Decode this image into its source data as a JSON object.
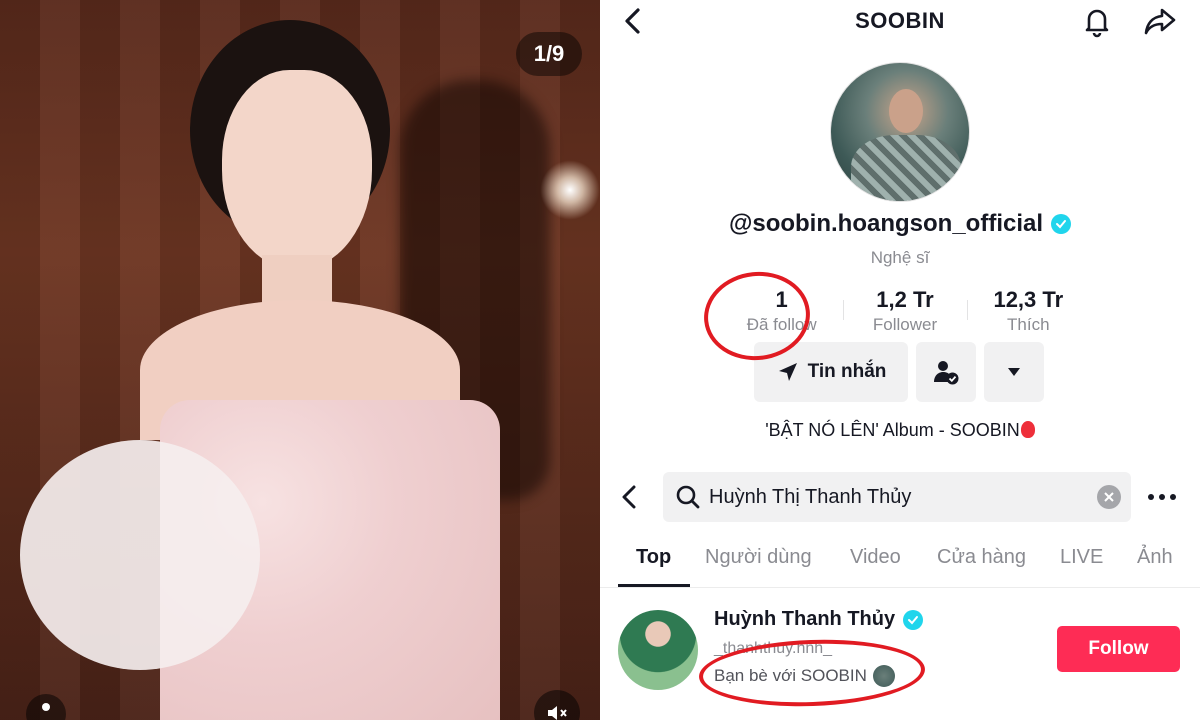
{
  "photo": {
    "counter": "1/9"
  },
  "profile": {
    "title": "SOOBIN",
    "handle": "@soobin.hoangson_official",
    "subtitle": "Nghệ sĩ",
    "stats": [
      {
        "value": "1",
        "label": "Đã follow"
      },
      {
        "value": "1,2 Tr",
        "label": "Follower"
      },
      {
        "value": "12,3 Tr",
        "label": "Thích"
      }
    ],
    "message_button": "Tin nhắn",
    "bio": "'BẬT NÓ LÊN' Album - SOOBIN"
  },
  "search": {
    "query": "Huỳnh Thị Thanh Thủy",
    "tabs": [
      "Top",
      "Người dùng",
      "Video",
      "Cửa hàng",
      "LIVE",
      "Ảnh"
    ],
    "active_tab": "Top"
  },
  "result": {
    "name": "Huỳnh Thanh Thủy",
    "handle": "_thanhthuy.hnh_",
    "friends_text": "Bạn bè với SOOBIN",
    "follow_label": "Follow"
  },
  "colors": {
    "follow": "#fe2c55",
    "verified": "#20d5ec",
    "annotation": "#e11b22"
  }
}
